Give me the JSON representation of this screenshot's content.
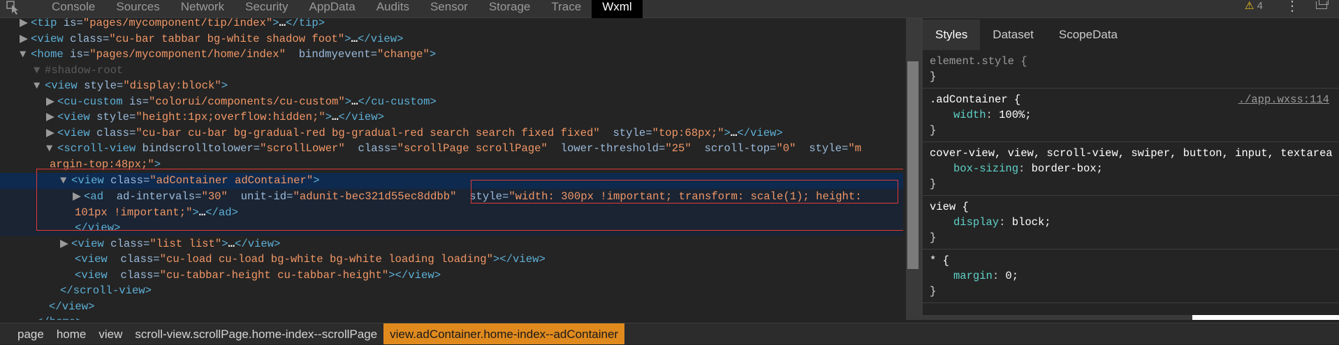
{
  "toolbar": {
    "tabs": [
      {
        "label": "Console"
      },
      {
        "label": "Sources"
      },
      {
        "label": "Network"
      },
      {
        "label": "Security"
      },
      {
        "label": "AppData"
      },
      {
        "label": "Audits"
      },
      {
        "label": "Sensor"
      },
      {
        "label": "Storage"
      },
      {
        "label": "Trace"
      },
      {
        "label": "Wxml"
      }
    ],
    "active_tab": "Wxml",
    "warning_count": "4",
    "warning_icon": "warning-triangle-icon"
  },
  "tree": {
    "lines": {
      "tip": {
        "tag": "tip",
        "is": "pages/mycomponent/tip/index",
        "close": "tip"
      },
      "view_bar": {
        "tag": "view",
        "class": "cu-bar tabbar bg-white shadow foot",
        "close": "view"
      },
      "home": {
        "tag": "home",
        "is": "pages/mycomponent/home/index",
        "bind_name": "bindmyevent",
        "bind_value": "change"
      },
      "shadow_root": "#shadow-root",
      "view_block": {
        "tag": "view",
        "style": "display:block"
      },
      "cu_custom": {
        "tag": "cu-custom",
        "is": "colorui/components/cu-custom",
        "close": "cu-custom"
      },
      "view_height": {
        "tag": "view",
        "style": "height:1px;overflow:hidden;",
        "close": "view"
      },
      "view_search": {
        "tag": "view",
        "class": "cu-bar cu-bar bg-gradual-red bg-gradual-red search search fixed fixed",
        "style": "top:68px;",
        "close": "view"
      },
      "scroll_view": {
        "tag": "scroll-view",
        "bindscrolltolower": "scrollLower",
        "class": "scrollPage scrollPage",
        "lower_threshold": "25",
        "scroll_top": "0",
        "style_part1": "m",
        "style_part2": "argin-top:48px;"
      },
      "ad_container": {
        "tag": "view",
        "class": "adContainer adContainer"
      },
      "ad": {
        "tag": "ad",
        "ad_intervals": "30",
        "unit_id": "adunit-bec321d55ec8ddbb",
        "style_part1": "width: 300px !important; transform: scale(1); height:",
        "style_part2": "101px !important;",
        "close": "ad"
      },
      "close_view": "view",
      "view_list": {
        "tag": "view",
        "class": "list list",
        "close": "view"
      },
      "view_loading": {
        "tag": "view",
        "class": "cu-load cu-load bg-white bg-white loading loading",
        "close": "view"
      },
      "view_tabbar_height": {
        "tag": "view",
        "class": "cu-tabbar-height cu-tabbar-height",
        "close": "view"
      },
      "close_scroll_view": "scroll-view",
      "close_view2": "view",
      "close_home": "home",
      "ellipsis": "…"
    }
  },
  "styles_panel": {
    "tabs": [
      {
        "label": "Styles"
      },
      {
        "label": "Dataset"
      },
      {
        "label": "ScopeData"
      }
    ],
    "rules": [
      {
        "selector": "element.style {",
        "close": "}"
      },
      {
        "selector": ".adContainer {",
        "source": "./app.wxss:114",
        "prop": "width",
        "value": "100%;",
        "close": "}"
      },
      {
        "selector": "cover-view, view, scroll-view, swiper, button, input, textarea",
        "prop": "box-sizing",
        "value": "border-box;",
        "close": "}"
      },
      {
        "selector": "view {",
        "prop": "display",
        "value": "block;",
        "close": "}"
      },
      {
        "selector": "* {",
        "prop": "margin",
        "value": "0;",
        "close": "}"
      }
    ]
  },
  "breadcrumb": [
    {
      "label": "page"
    },
    {
      "label": "home"
    },
    {
      "label": "view"
    },
    {
      "label": "scroll-view.scrollPage.home-index--scrollPage"
    },
    {
      "label": "view.adContainer.home-index--adContainer"
    }
  ],
  "colors": {
    "active_crumb": "#e08a1e",
    "selection_box": "#e03a3a",
    "tag": "#5db0d7",
    "attr_value": "#f29766"
  }
}
